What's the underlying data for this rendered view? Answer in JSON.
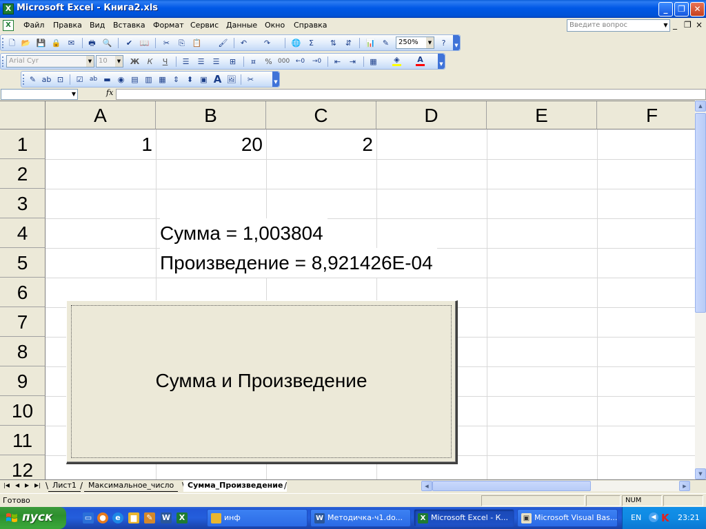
{
  "window": {
    "title": "Microsoft Excel - Книга2.xls",
    "app_icon": "excel-icon"
  },
  "menu": {
    "items": [
      "Файл",
      "Правка",
      "Вид",
      "Вставка",
      "Формат",
      "Сервис",
      "Данные",
      "Окно",
      "Справка"
    ],
    "help_placeholder": "Введите вопрос"
  },
  "toolbar_standard": {
    "zoom": "250%"
  },
  "toolbar_formatting": {
    "font": "Arial Cyr",
    "size": "10",
    "bold_label": "Ж",
    "italic_label": "К",
    "underline_label": "Ч",
    "percent_label": "%",
    "thousands_label": "000",
    "fill_color": "#FFFF00",
    "font_color": "#FF0000"
  },
  "formula_bar": {
    "fx_label": "fx",
    "name_box": "",
    "formula": ""
  },
  "grid": {
    "columns": [
      "A",
      "B",
      "C",
      "D",
      "E",
      "F"
    ],
    "rows": [
      "1",
      "2",
      "3",
      "4",
      "5",
      "6",
      "7",
      "8",
      "9",
      "10",
      "11",
      "12"
    ],
    "cells": {
      "A1": "1",
      "B1": "20",
      "C1": "2",
      "B4": "Сумма = 1,003804",
      "B5": "Произведение = 8,921426E-04"
    }
  },
  "form_button": {
    "label": "Сумма и Произведение"
  },
  "sheet_tabs": [
    "Лист1",
    "Максимальное_число",
    "Сумма_Произведение"
  ],
  "active_sheet": "Сумма_Произведение",
  "status": {
    "text": "Готово",
    "num": "NUM"
  },
  "taskbar": {
    "start_label": "пуск",
    "tasks": [
      "инф",
      "Методичка-ч1.do...",
      "Microsoft Excel - К...",
      "Microsoft Visual Bas..."
    ],
    "active_task": "Microsoft Excel - К...",
    "lang": "EN",
    "clock": "23:21"
  }
}
